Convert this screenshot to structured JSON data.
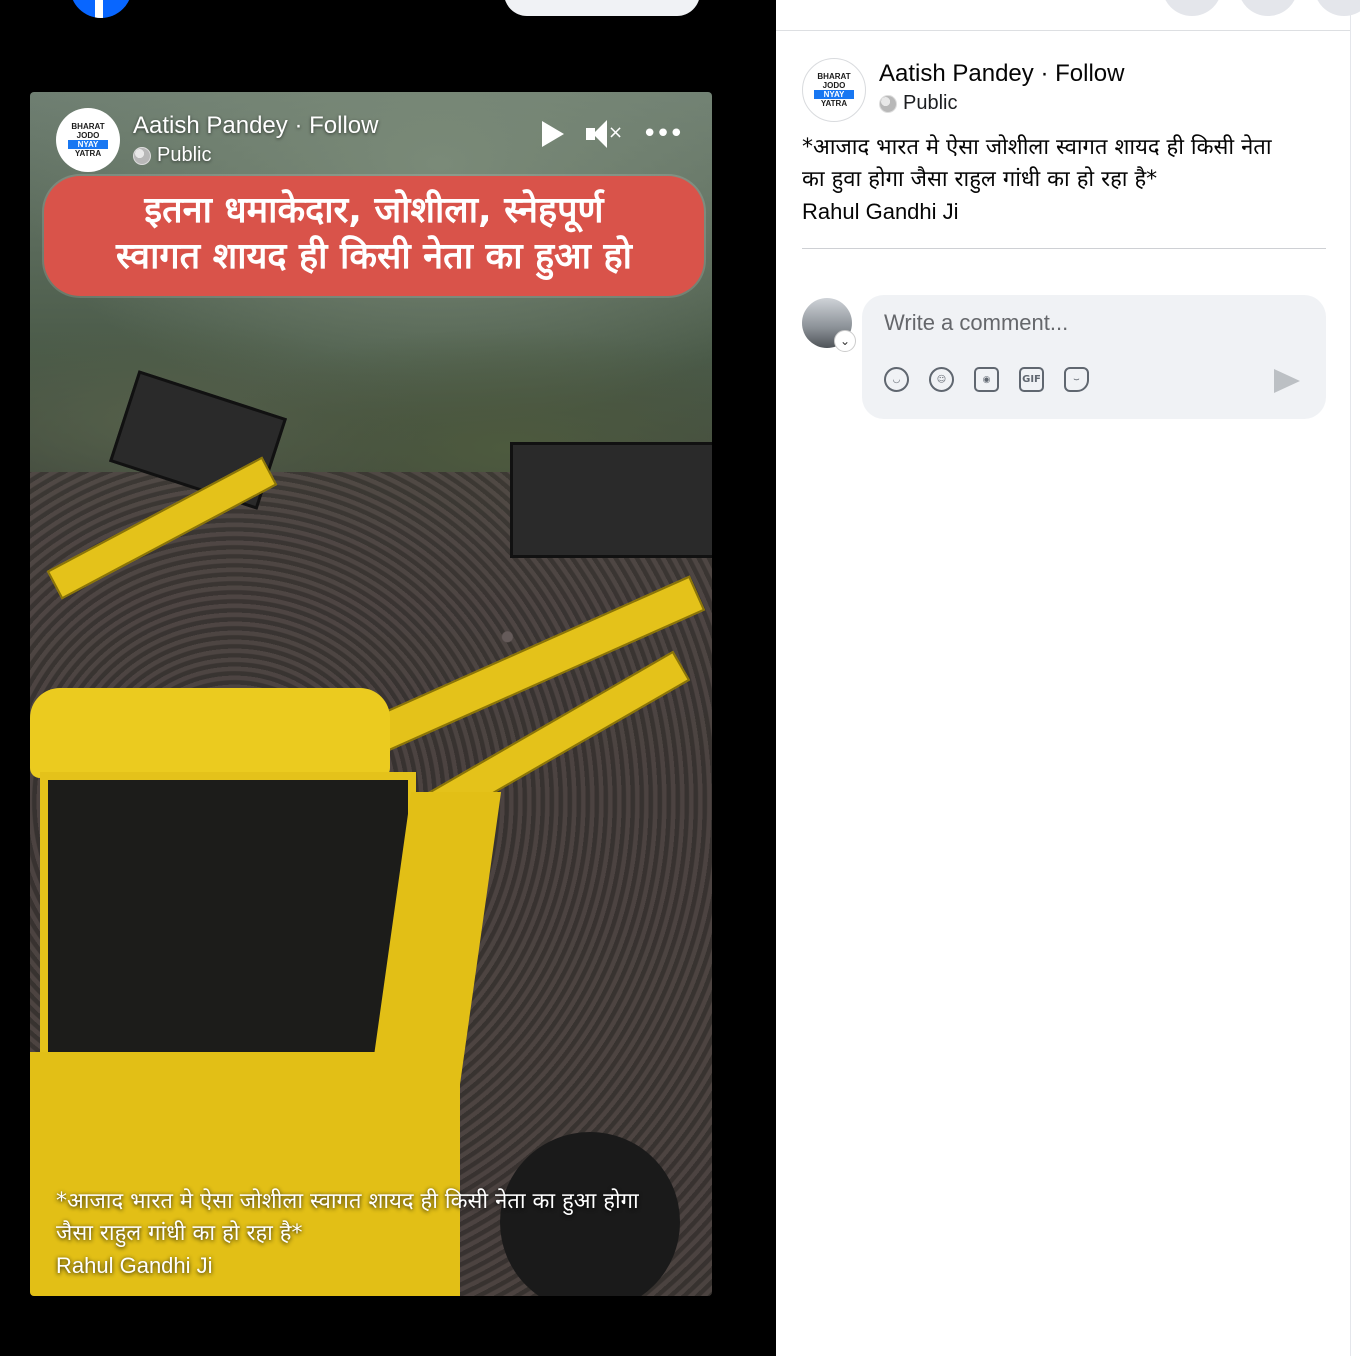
{
  "video": {
    "author": "Aatish Pandey · Follow",
    "audience": "Public",
    "banner_line1": "इतना धमाकेदार, जोशीला, स्नेहपूर्ण",
    "banner_line2": "स्वागत शायद ही किसी नेता का हुआ हो",
    "caption_line1": "*आजाद भारत मे ऐसा जोशीला स्वागत शायद ही किसी नेता का हुआ होगा",
    "caption_line2": "जैसा राहुल गांधी का हो रहा है*",
    "caption_line3": "Rahul Gandhi Ji"
  },
  "avatar_logo": {
    "line1": "BHARAT JODO",
    "line2": "NYAY",
    "line3": "YATRA"
  },
  "post": {
    "author": "Aatish Pandey · Follow",
    "audience": "Public",
    "text_line1": "*आजाद भारत मे ऐसा जोशीला स्वागत शायद ही किसी नेता",
    "text_line2": "का हुवा होगा जैसा राहुल गांधी का हो रहा है*",
    "text_line3": "Rahul Gandhi Ji"
  },
  "comment": {
    "placeholder": "Write a comment...",
    "tools": [
      "avatar-sticker-icon",
      "emoji-icon",
      "camera-icon",
      "gif-icon",
      "sticker-icon"
    ],
    "gif_label": "GIF"
  },
  "colors": {
    "brand": "#0866ff",
    "banner": "#d9534a",
    "machine_yellow": "#e4c21a",
    "comment_bg": "#f0f2f5"
  }
}
